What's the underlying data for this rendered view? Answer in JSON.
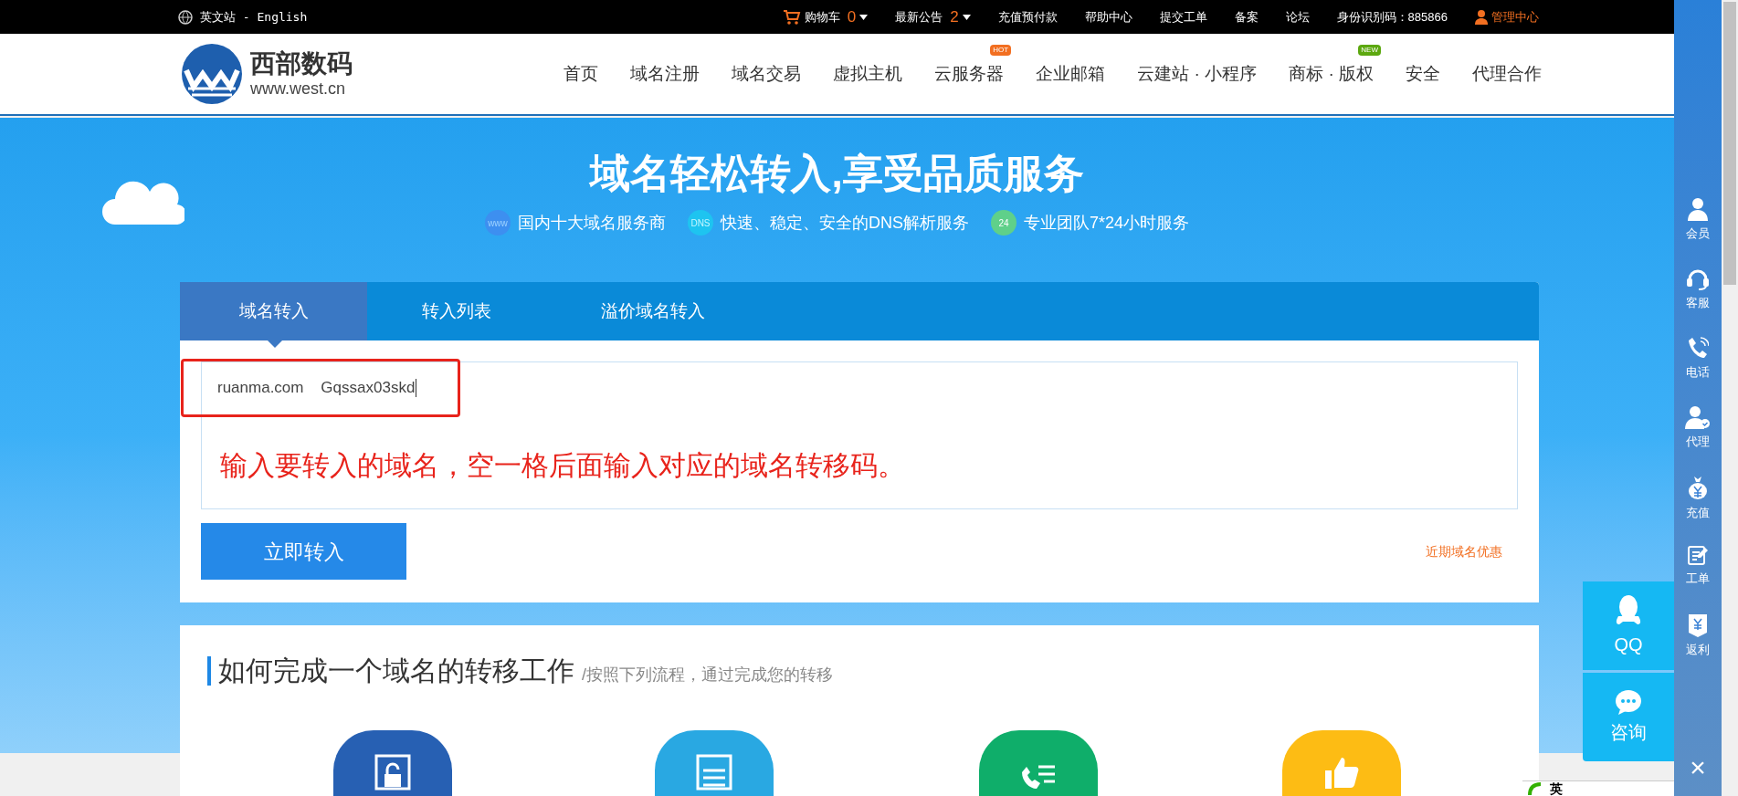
{
  "top_bar": {
    "language": "英文站 - English",
    "links": [
      {
        "label": "购物车",
        "count": "0",
        "kind": "cart"
      },
      {
        "label": "最新公告",
        "count": "2",
        "kind": "notice"
      },
      {
        "label": "充值预付款",
        "kind": "plain"
      },
      {
        "label": "帮助中心",
        "kind": "plain"
      },
      {
        "label": "提交工单",
        "kind": "plain"
      },
      {
        "label": "备案",
        "kind": "plain"
      },
      {
        "label": "论坛",
        "kind": "plain"
      },
      {
        "label": "身份识别码：885866",
        "kind": "plain"
      }
    ],
    "account": "管理中心"
  },
  "header": {
    "logo_name": "西部数码",
    "logo_url": "www.west.cn",
    "nav": [
      {
        "label": "首页"
      },
      {
        "label": "域名注册"
      },
      {
        "label": "域名交易"
      },
      {
        "label": "虚拟主机"
      },
      {
        "label": "云服务器",
        "badge": "HOT"
      },
      {
        "label": "企业邮箱"
      },
      {
        "label": "云建站 · 小程序"
      },
      {
        "label": "商标 · 版权",
        "badge": "NEW"
      },
      {
        "label": "安全"
      },
      {
        "label": "代理合作"
      }
    ]
  },
  "hero": {
    "title": "域名轻松转入,享受品质服务",
    "features": [
      {
        "icon_text": "www",
        "text": "国内十大域名服务商"
      },
      {
        "icon_text": "DNS",
        "text": "快速、稳定、安全的DNS解析服务"
      },
      {
        "icon_text": "24",
        "text": "专业团队7*24小时服务"
      }
    ]
  },
  "transfer": {
    "tabs": [
      {
        "label": "域名转入",
        "selected": true
      },
      {
        "label": "转入列表",
        "selected": false
      },
      {
        "label": "溢价域名转入",
        "selected": false
      }
    ],
    "input_value": "ruanma.com    Gqssax03skd",
    "annotation": "输入要转入的域名，空一格后面输入对应的域名转移码。",
    "submit": "立即转入",
    "promo_link": "近期域名优惠"
  },
  "how_to": {
    "title": "如何完成一个域名的转移工作",
    "subtitle": "/按照下列流程，通过完成您的转移",
    "steps": [
      {
        "color": "#2760b3"
      },
      {
        "color": "#29a8e2"
      },
      {
        "color": "#0fae6a"
      },
      {
        "color": "#fdbc14"
      }
    ]
  },
  "side_bar": {
    "items": [
      {
        "label": "会员"
      },
      {
        "label": "客服"
      },
      {
        "label": "电话"
      },
      {
        "label": "代理"
      },
      {
        "label": "充值"
      },
      {
        "label": "工单"
      },
      {
        "label": "返利"
      }
    ],
    "close": "×"
  },
  "float_buttons": [
    {
      "label": "QQ"
    },
    {
      "label": "咨询"
    }
  ],
  "ime_bar": {
    "mode": "英"
  }
}
